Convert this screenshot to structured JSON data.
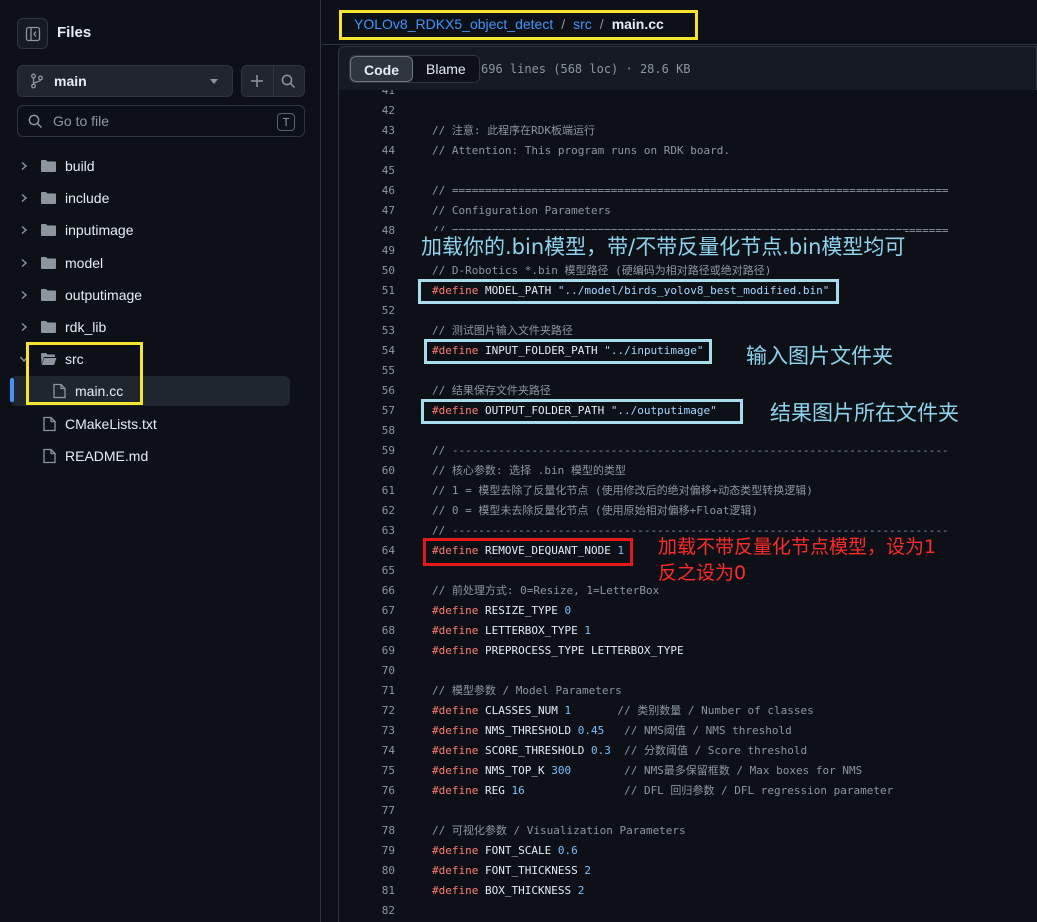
{
  "sidebar": {
    "title": "Files",
    "branch": "main",
    "search_placeholder": "Go to file",
    "search_shortcut": "T",
    "tree": [
      {
        "label": "build",
        "kind": "folder",
        "expanded": false
      },
      {
        "label": "include",
        "kind": "folder",
        "expanded": false
      },
      {
        "label": "inputimage",
        "kind": "folder",
        "expanded": false
      },
      {
        "label": "model",
        "kind": "folder",
        "expanded": false
      },
      {
        "label": "outputimage",
        "kind": "folder",
        "expanded": false
      },
      {
        "label": "rdk_lib",
        "kind": "folder",
        "expanded": false
      },
      {
        "label": "src",
        "kind": "folder",
        "expanded": true
      },
      {
        "label": "main.cc",
        "kind": "file",
        "active": true
      },
      {
        "label": "CMakeLists.txt",
        "kind": "file"
      },
      {
        "label": "README.md",
        "kind": "file"
      }
    ]
  },
  "breadcrumb": {
    "repo": "YOLOv8_RDKX5_object_detect",
    "sep": "/",
    "folder": "src",
    "file": "main.cc"
  },
  "file_bar": {
    "code_tab": "Code",
    "blame_tab": "Blame",
    "meta": "696 lines (568 loc) · 28.6 KB"
  },
  "code": [
    {
      "n": "41",
      "t": [
        [
          "c",
          ""
        ]
      ]
    },
    {
      "n": "42",
      "t": []
    },
    {
      "n": "43",
      "t": [
        [
          "c",
          "// 注意: 此程序在RDK板端运行"
        ]
      ]
    },
    {
      "n": "44",
      "t": [
        [
          "c",
          "// Attention: This program runs on RDK board."
        ]
      ]
    },
    {
      "n": "45",
      "t": []
    },
    {
      "n": "46",
      "t": [
        [
          "c",
          "// ==========================================================================="
        ]
      ]
    },
    {
      "n": "47",
      "t": [
        [
          "c",
          "// Configuration Parameters"
        ]
      ]
    },
    {
      "n": "48",
      "t": [
        [
          "c",
          "// ==========================================================================="
        ]
      ]
    },
    {
      "n": "49",
      "t": []
    },
    {
      "n": "50",
      "t": [
        [
          "c",
          "// D-Robotics *.bin 模型路径 (硬编码为相对路径或绝对路径)"
        ]
      ]
    },
    {
      "n": "51",
      "t": [
        [
          "k",
          "#define"
        ],
        [
          "i",
          " MODEL_PATH "
        ],
        [
          "s",
          "\"../model/birds_yolov8_best_modified.bin\""
        ]
      ]
    },
    {
      "n": "52",
      "t": []
    },
    {
      "n": "53",
      "t": [
        [
          "c",
          "// 测试图片输入文件夹路径"
        ]
      ]
    },
    {
      "n": "54",
      "t": [
        [
          "k",
          "#define"
        ],
        [
          "i",
          " INPUT_FOLDER_PATH "
        ],
        [
          "s",
          "\"../inputimage\""
        ]
      ]
    },
    {
      "n": "55",
      "t": []
    },
    {
      "n": "56",
      "t": [
        [
          "c",
          "// 结果保存文件夹路径"
        ]
      ]
    },
    {
      "n": "57",
      "t": [
        [
          "k",
          "#define"
        ],
        [
          "i",
          " OUTPUT_FOLDER_PATH "
        ],
        [
          "s",
          "\"../outputimage\""
        ]
      ]
    },
    {
      "n": "58",
      "t": []
    },
    {
      "n": "59",
      "t": [
        [
          "c",
          "// ---------------------------------------------------------------------------"
        ]
      ]
    },
    {
      "n": "60",
      "t": [
        [
          "c",
          "// 核心参数: 选择 .bin 模型的类型"
        ]
      ]
    },
    {
      "n": "61",
      "t": [
        [
          "c",
          "// 1 = 模型去除了反量化节点 (使用修改后的绝对偏移+动态类型转换逻辑)"
        ]
      ]
    },
    {
      "n": "62",
      "t": [
        [
          "c",
          "// 0 = 模型未去除反量化节点 (使用原始相对偏移+Float逻辑)"
        ]
      ]
    },
    {
      "n": "63",
      "t": [
        [
          "c",
          "// ---------------------------------------------------------------------------"
        ]
      ]
    },
    {
      "n": "64",
      "t": [
        [
          "k",
          "#define"
        ],
        [
          "i",
          " REMOVE_DEQUANT_NODE "
        ],
        [
          "n",
          "1"
        ]
      ]
    },
    {
      "n": "65",
      "t": []
    },
    {
      "n": "66",
      "t": [
        [
          "c",
          "// 前处理方式: 0=Resize, 1=LetterBox"
        ]
      ]
    },
    {
      "n": "67",
      "t": [
        [
          "k",
          "#define"
        ],
        [
          "i",
          " RESIZE_TYPE "
        ],
        [
          "n",
          "0"
        ]
      ]
    },
    {
      "n": "68",
      "t": [
        [
          "k",
          "#define"
        ],
        [
          "i",
          " LETTERBOX_TYPE "
        ],
        [
          "n",
          "1"
        ]
      ]
    },
    {
      "n": "69",
      "t": [
        [
          "k",
          "#define"
        ],
        [
          "i",
          " PREPROCESS_TYPE LETTERBOX_TYPE"
        ]
      ]
    },
    {
      "n": "70",
      "t": []
    },
    {
      "n": "71",
      "t": [
        [
          "c",
          "// 模型参数 / Model Parameters"
        ]
      ]
    },
    {
      "n": "72",
      "t": [
        [
          "k",
          "#define"
        ],
        [
          "i",
          " CLASSES_NUM "
        ],
        [
          "n",
          "1"
        ],
        [
          "c",
          "       // 类别数量 / Number of classes"
        ]
      ]
    },
    {
      "n": "73",
      "t": [
        [
          "k",
          "#define"
        ],
        [
          "i",
          " NMS_THRESHOLD "
        ],
        [
          "n",
          "0.45"
        ],
        [
          "c",
          "   // NMS阈值 / NMS threshold"
        ]
      ]
    },
    {
      "n": "74",
      "t": [
        [
          "k",
          "#define"
        ],
        [
          "i",
          " SCORE_THRESHOLD "
        ],
        [
          "n",
          "0.3"
        ],
        [
          "c",
          "  // 分数阈值 / Score threshold"
        ]
      ]
    },
    {
      "n": "75",
      "t": [
        [
          "k",
          "#define"
        ],
        [
          "i",
          " NMS_TOP_K "
        ],
        [
          "n",
          "300"
        ],
        [
          "c",
          "        // NMS最多保留框数 / Max boxes for NMS"
        ]
      ]
    },
    {
      "n": "76",
      "t": [
        [
          "k",
          "#define"
        ],
        [
          "i",
          " REG "
        ],
        [
          "n",
          "16"
        ],
        [
          "c",
          "               // DFL 回归参数 / DFL regression parameter"
        ]
      ]
    },
    {
      "n": "77",
      "t": []
    },
    {
      "n": "78",
      "t": [
        [
          "c",
          "// 可视化参数 / Visualization Parameters"
        ]
      ]
    },
    {
      "n": "79",
      "t": [
        [
          "k",
          "#define"
        ],
        [
          "i",
          " FONT_SCALE "
        ],
        [
          "n",
          "0.6"
        ]
      ]
    },
    {
      "n": "80",
      "t": [
        [
          "k",
          "#define"
        ],
        [
          "i",
          " FONT_THICKNESS "
        ],
        [
          "n",
          "2"
        ]
      ]
    },
    {
      "n": "81",
      "t": [
        [
          "k",
          "#define"
        ],
        [
          "i",
          " BOX_THICKNESS "
        ],
        [
          "n",
          "2"
        ]
      ]
    },
    {
      "n": "82",
      "t": []
    }
  ],
  "annotations": {
    "model_note": "加载你的.bin模型，带/不带反量化节点.bin模型均可",
    "input_note": "输入图片文件夹",
    "output_note": "结果图片所在文件夹",
    "dequant_note_line1": "加载不带反量化节点模型，设为1",
    "dequant_note_line2": "反之设为0",
    "colors": {
      "yellow": "#f6e52f",
      "blue": "#a8dcec",
      "red": "#e8171b"
    }
  }
}
